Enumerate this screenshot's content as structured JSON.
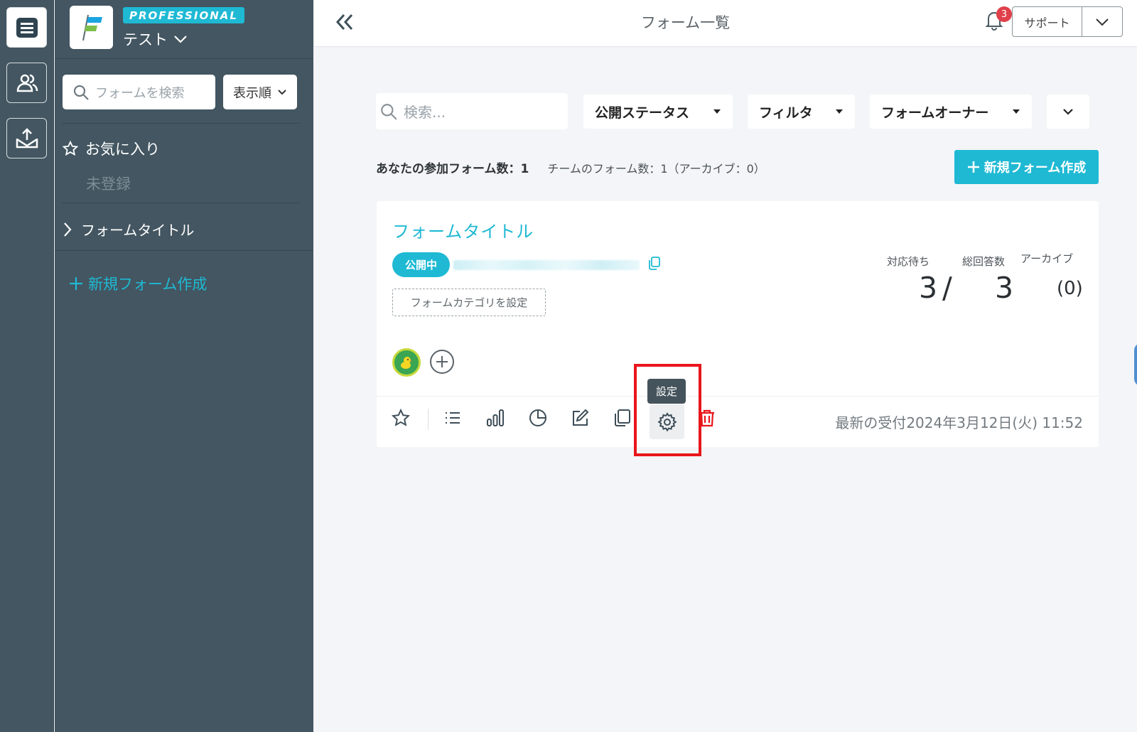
{
  "rail": {
    "items": [
      {
        "name": "forms",
        "icon": "form-list-icon",
        "active": true
      },
      {
        "name": "members",
        "icon": "users-icon",
        "active": false
      },
      {
        "name": "export",
        "icon": "inbox-upload-icon",
        "active": false
      }
    ]
  },
  "sidebar": {
    "plan": "PROFESSIONAL",
    "team_name": "テスト",
    "search_placeholder": "フォームを検索",
    "sort_label": "表示順",
    "favorites_label": "お気に入り",
    "favorites_empty": "未登録",
    "forms": [
      {
        "label": "フォームタイトル"
      }
    ],
    "new_form_label": "新規フォーム作成"
  },
  "header": {
    "title": "フォーム一覧",
    "notification_count": "3",
    "support_label": "サポート"
  },
  "filters": {
    "search_placeholder": "検索...",
    "status_label": "公開ステータス",
    "filter_label": "フィルタ",
    "owner_label": "フォームオーナー"
  },
  "summary": {
    "participating": "あなたの参加フォーム数：1",
    "team": "チームのフォーム数：1（アーカイブ：0）",
    "new_form_button": "新規フォーム作成"
  },
  "form_card": {
    "title": "フォームタイトル",
    "status": "公開中",
    "category_placeholder": "フォームカテゴリを設定",
    "stats": {
      "pending_label": "対応待ち",
      "total_label": "総回答数",
      "archive_label": "アーカイブ",
      "pending": "3",
      "separator": "/",
      "total": "3",
      "archive": "(0)"
    },
    "last_received": "最新の受付2024年3月12日(火) 11:52",
    "tooltip": "設定"
  },
  "colors": {
    "accent": "#1fb9d4",
    "sidebar_bg": "#435661",
    "highlight": "#e8161b",
    "danger": "#e8161b"
  }
}
